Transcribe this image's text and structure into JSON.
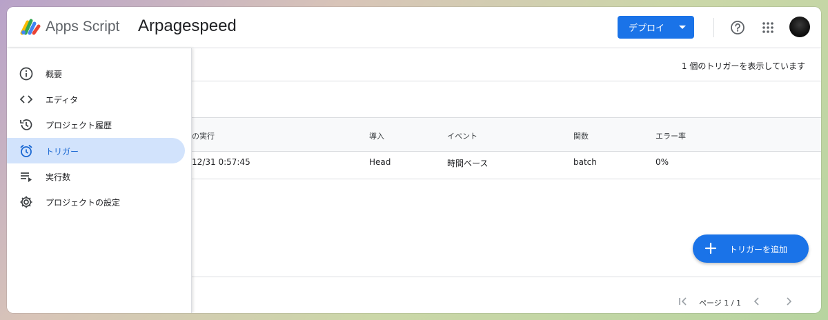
{
  "header": {
    "brand": "Apps Script",
    "project_title": "Arpagespeed",
    "deploy_label": "デプロイ",
    "icons": [
      "apps-script-logo",
      "help-icon",
      "apps-grid-icon",
      "avatar"
    ]
  },
  "sidebar": {
    "items": [
      {
        "label": "概要",
        "icon": "info-icon",
        "active": false
      },
      {
        "label": "エディタ",
        "icon": "code-icon",
        "active": false
      },
      {
        "label": "プロジェクト履歴",
        "icon": "history-icon",
        "active": false
      },
      {
        "label": "トリガー",
        "icon": "alarm-icon",
        "active": true
      },
      {
        "label": "実行数",
        "icon": "executions-icon",
        "active": false
      },
      {
        "label": "プロジェクトの設定",
        "icon": "gear-icon",
        "active": false
      }
    ]
  },
  "main": {
    "summary": "1 個のトリガーを表示しています",
    "columns": [
      "の実行",
      "導入",
      "イベント",
      "関数",
      "エラー率"
    ],
    "rows": [
      {
        "last_run": "/12/31 0:57:45",
        "deployment": "Head",
        "event": "時間ベース",
        "function": "batch",
        "error_rate": "0%"
      }
    ],
    "add_trigger_label": "トリガーを追加",
    "pager_label": "ページ 1 / 1"
  },
  "colors": {
    "accent": "#1a73e8",
    "active_nav_bg": "#d2e3fc",
    "active_nav_text": "#1967d2"
  }
}
